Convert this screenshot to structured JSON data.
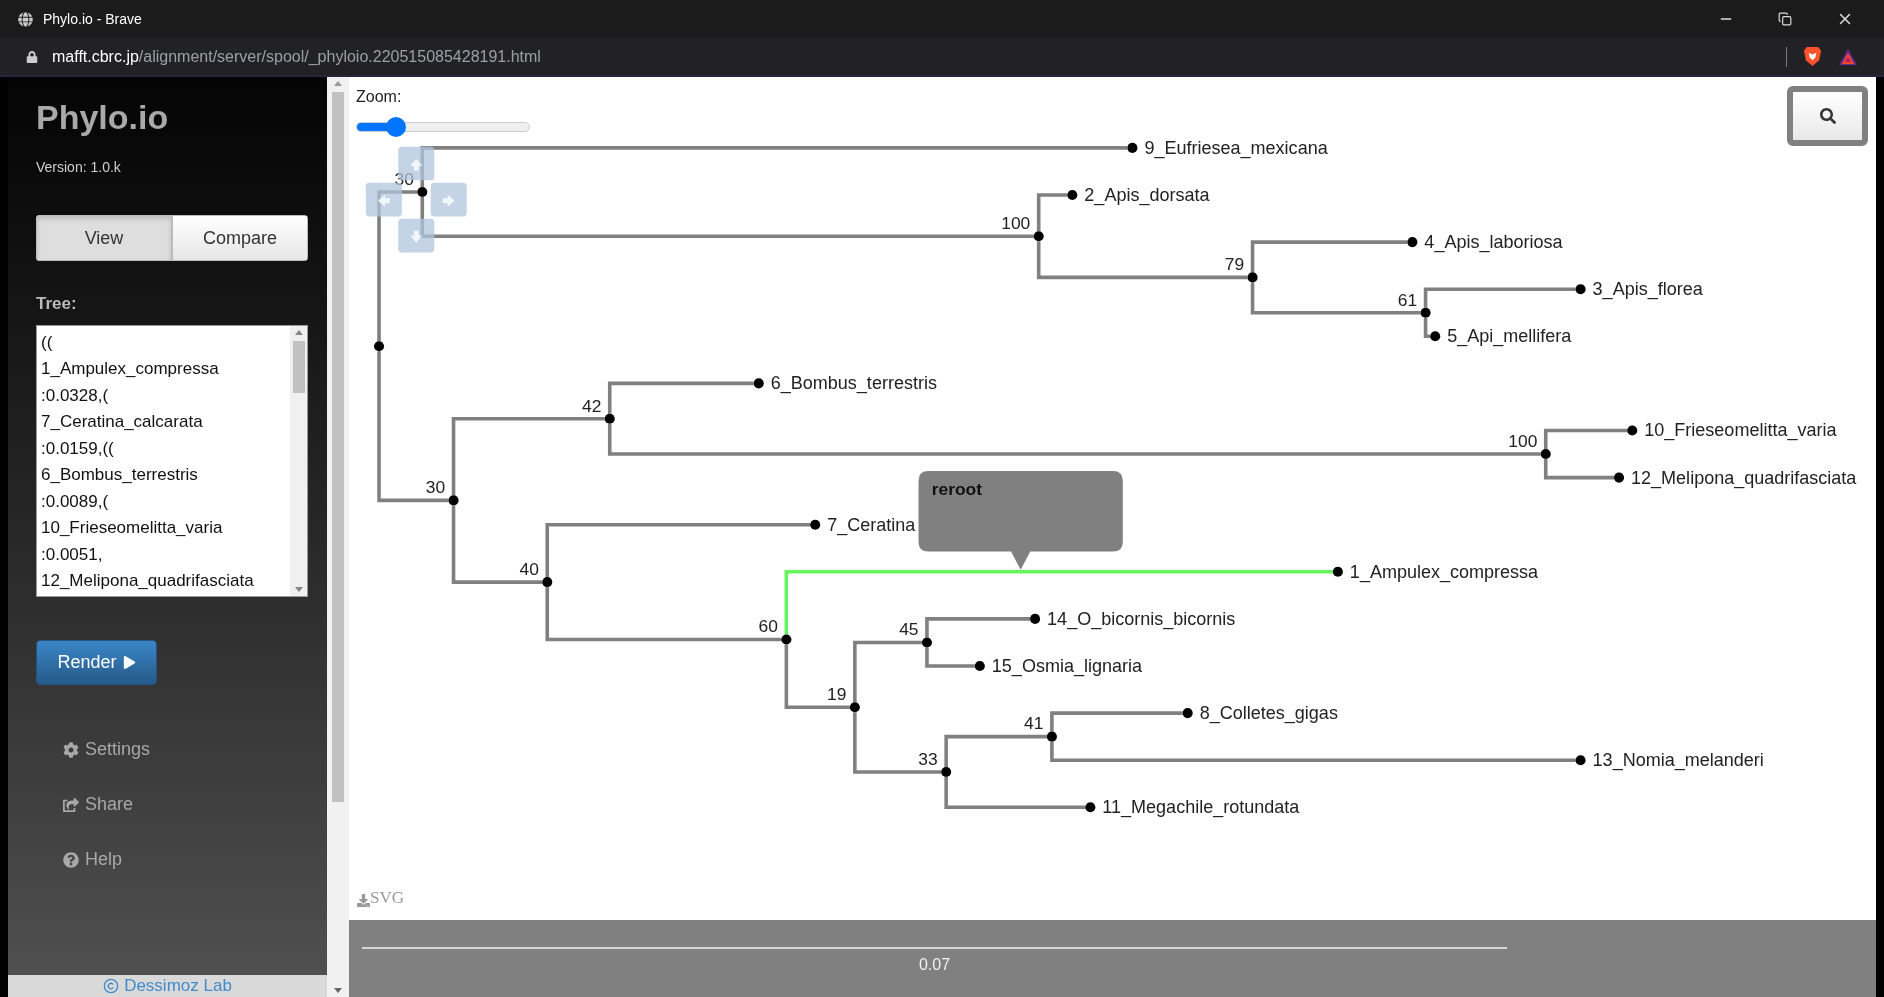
{
  "browser": {
    "tab_title": "Phylo.io - Brave",
    "url_host": "mafft.cbrc.jp",
    "url_path": "/alignment/server/spool/_phyloio.220515085428191.html"
  },
  "sidebar": {
    "title": "Phylo.io",
    "version": "Version: 1.0.k",
    "modes": [
      {
        "label": "View",
        "selected": true
      },
      {
        "label": "Compare",
        "selected": false
      }
    ],
    "tree_label": "Tree:",
    "tree_text": "((\n1_Ampulex_compressa\n:0.0328,(\n7_Ceratina_calcarata\n:0.0159,((\n6_Bombus_terrestris\n:0.0089,(\n10_Frieseomelitta_varia\n:0.0051,\n12_Melipona_quadrifasciata",
    "render_button": "Render",
    "menu": [
      {
        "kind": "settings",
        "label": "Settings"
      },
      {
        "kind": "share",
        "label": "Share"
      },
      {
        "kind": "help",
        "label": "Help"
      }
    ],
    "footer_link": "Dessimoz Lab"
  },
  "viewer": {
    "zoom_label": "Zoom:",
    "zoom": {
      "level": 0.23
    },
    "tooltip": "reroot",
    "export_link": "SVG",
    "scale_label": "0.07",
    "tree": {
      "children": [
        {
          "support": "30",
          "highlighted": false,
          "children": [
            {
              "name": "9_Eufriesea_mexicana",
              "highlighted": false
            },
            {
              "support": "100",
              "highlighted": false,
              "children": [
                {
                  "name": "2_Apis_dorsata",
                  "highlighted": false
                },
                {
                  "support": "79",
                  "highlighted": false,
                  "children": [
                    {
                      "name": "4_Apis_laboriosa",
                      "highlighted": false
                    },
                    {
                      "support": "61",
                      "highlighted": false,
                      "children": [
                        {
                          "name": "3_Apis_florea",
                          "highlighted": false
                        },
                        {
                          "name": "5_Api_mellifera",
                          "highlighted": false
                        }
                      ]
                    }
                  ]
                }
              ]
            }
          ]
        },
        {
          "support": "30",
          "highlighted": false,
          "children": [
            {
              "support": "42",
              "highlighted": false,
              "children": [
                {
                  "name": "6_Bombus_terrestris",
                  "highlighted": false
                },
                {
                  "support": "100",
                  "highlighted": false,
                  "children": [
                    {
                      "name": "10_Frieseomelitta_varia",
                      "highlighted": false
                    },
                    {
                      "name": "12_Melipona_quadrifasciata",
                      "highlighted": false
                    }
                  ]
                }
              ]
            },
            {
              "support": "40",
              "highlighted": false,
              "children": [
                {
                  "name": "7_Ceratina",
                  "highlighted": false
                },
                {
                  "support": "60",
                  "highlighted": false,
                  "children": [
                    {
                      "name": "1_Ampulex_compressa",
                      "highlighted": true
                    },
                    {
                      "support": "19",
                      "highlighted": false,
                      "children": [
                        {
                          "support": "45",
                          "highlighted": false,
                          "children": [
                            {
                              "name": "14_O_bicornis_bicornis",
                              "highlighted": false
                            },
                            {
                              "name": "15_Osmia_lignaria",
                              "highlighted": false
                            }
                          ]
                        },
                        {
                          "support": "33",
                          "highlighted": false,
                          "children": [
                            {
                              "support": "41",
                              "highlighted": false,
                              "children": [
                                {
                                  "name": "8_Colletes_gigas",
                                  "highlighted": false
                                },
                                {
                                  "name": "13_Nomia_melanderi",
                                  "highlighted": false
                                }
                              ]
                            },
                            {
                              "name": "11_Megachile_rotundata",
                              "highlighted": false
                            }
                          ]
                        }
                      ]
                    }
                  ]
                }
              ]
            }
          ]
        }
      ]
    }
  }
}
